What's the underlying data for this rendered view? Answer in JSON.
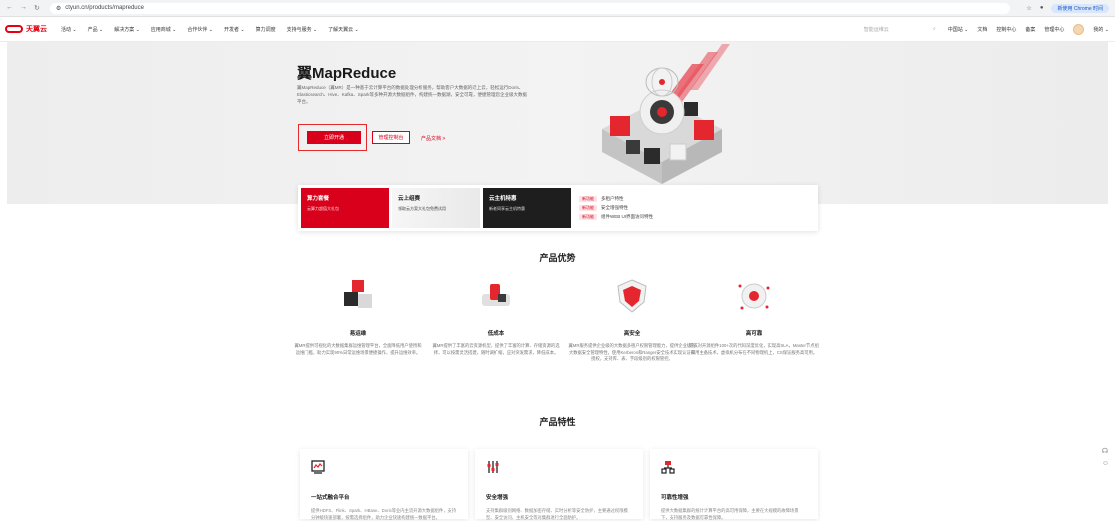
{
  "browser": {
    "url": "ctyun.cn/products/mapreduce",
    "profile_label": "新使用 Chrome 时间",
    "icons": [
      "arrow-left-icon",
      "arrow-right-icon",
      "reload-icon",
      "site-info-icon",
      "star-icon",
      "account-icon"
    ]
  },
  "header": {
    "logo_text": "天翼云",
    "nav": [
      "活动 ⌄",
      "产品 ⌄",
      "解决方案 ⌄",
      "应用商城 ⌄",
      "合作伙伴 ⌄",
      "开发者 ⌄",
      "算力调度",
      "支持与服务 ⌄",
      "了解天翼云 ⌄"
    ],
    "search_placeholder": "智能运维云",
    "right_links": [
      "中国站 ⌄",
      "文档",
      "控制中心",
      "备案",
      "管理中心"
    ],
    "user_label": "我的 ⌄"
  },
  "hero": {
    "title": "翼MapReduce",
    "description": "翼MapReduce（翼MR）是一种基于云计算平台的数据处理分析服务，帮助客户大数据的迁上云，轻松运行Doris、Elasticsearch、Hive、Kafka、Spark等多种开源大数据组件，构建统一数据湖，安全可靠，便捷管理您企业级大数据平台。",
    "primary_button": "立即开通",
    "secondary_button": "管理控制台",
    "doc_link": "产品文档 >"
  },
  "promo": {
    "cards": [
      {
        "title": "算力套餐",
        "subtitle": "云算力超值大礼包"
      },
      {
        "title": "云上组赛",
        "subtitle": "领取云方案大礼包免费试用"
      },
      {
        "title": "云主机特惠",
        "subtitle": "新老同享云主机特惠"
      }
    ],
    "news": [
      {
        "tag": "新功能",
        "text": "多租户特性"
      },
      {
        "tag": "新功能",
        "text": "安全增强特性"
      },
      {
        "tag": "新功能",
        "text": "组件WEB UI界面访问特性"
      }
    ]
  },
  "advantages": {
    "title": "产品优势",
    "items": [
      {
        "name": "易运维",
        "desc": "翼MR提供可视化的大数据集群运维管理平台，全面降低用户使用和运维门槛，助力实现90%日常运维场景便捷操作，提升运维效率。"
      },
      {
        "name": "低成本",
        "desc": "翼MR提供了丰富的云资源机型，提供了丰富的计算、存储资源的选择，可以按需灵活搭建，随时调扩缩，应对突发需求，降低成本。"
      },
      {
        "name": "高安全",
        "desc": "翼MR服务提供企业级的大数据多租户权限管理能力，提供企业级的大数据安全管理特性，使用Kerberos和Ranger安全技术实现认证和授权，支持库、表、字段级别的权限管控。"
      },
      {
        "name": "高可靠",
        "desc": "完成对开源组件100+次的代码深度优化，实现高SLA，Master节点组采用主备技术，虚拟机分布在不同物理机上，CS保证服务高可用。"
      }
    ]
  },
  "features": {
    "title": "产品特性",
    "items": [
      {
        "name": "一站式融合平台",
        "desc": "提供HDFS、Flink、Spark、HBase、Doris等业内主流开源大数据组件，支持分钟级快速部署，按需选择组件，助力企业快速构建统一数据平台。"
      },
      {
        "name": "安全增强",
        "desc": "支持集群级别网络、数据加密存储、实时分析等安全防护，主要通过权限模型、安全访问、主机安全等对集群进行全面防护。"
      },
      {
        "name": "可靠性增强",
        "desc": "提供大数据集群的统计计算平台的高可用保障，主要在大规模的故障场景下，支持服务及数据可靠性保障。"
      }
    ]
  },
  "float_tools": [
    "headset-icon",
    "chat-icon"
  ]
}
